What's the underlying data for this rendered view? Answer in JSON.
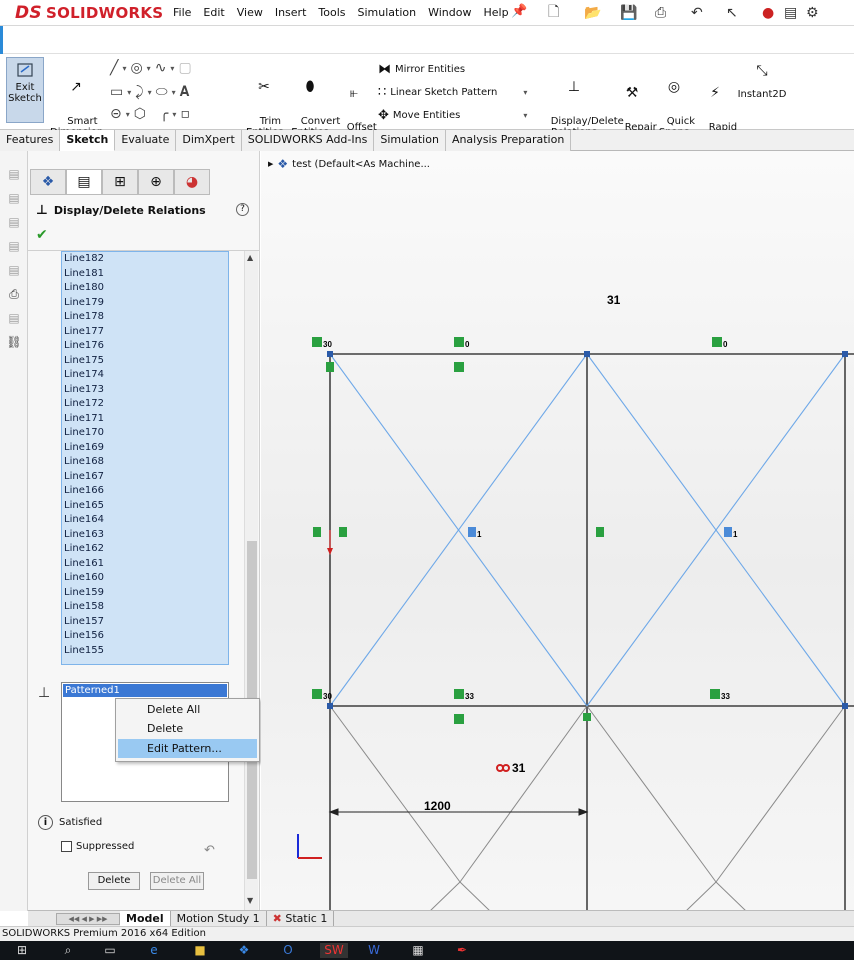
{
  "app": {
    "brand_ds": "DS",
    "brand_solid": "SOLIDWORKS"
  },
  "menu": [
    "File",
    "Edit",
    "View",
    "Insert",
    "Tools",
    "Simulation",
    "Window",
    "Help"
  ],
  "ribbon": {
    "exit_sketch": "Exit\nSketch",
    "smart_dimension": "Smart\nDimension",
    "trim_entities": "Trim\nEntities",
    "convert_entities": "Convert\nEntities",
    "offset_entities": "Offset\nEntities",
    "mirror_entities": "Mirror Entities",
    "linear_sketch_pattern": "Linear Sketch Pattern",
    "move_entities": "Move Entities",
    "display_delete_relations": "Display/Delete\nRelations",
    "repair_sketch": "Repair\nSketch",
    "quick_snaps": "Quick\nSnaps",
    "rapid_sketch": "Rapid\nSketch",
    "instant2d": "Instant2D"
  },
  "tabs": [
    "Features",
    "Sketch",
    "Evaluate",
    "DimXpert",
    "SOLIDWORKS Add-Ins",
    "Simulation",
    "Analysis Preparation"
  ],
  "active_tab": "Sketch",
  "property_manager": {
    "title": "Display/Delete Relations",
    "help": "?",
    "entities": [
      "Line182",
      "Line181",
      "Line180",
      "Line179",
      "Line178",
      "Line177",
      "Line176",
      "Line175",
      "Line174",
      "Line173",
      "Line172",
      "Line171",
      "Line170",
      "Line169",
      "Line168",
      "Line167",
      "Line166",
      "Line165",
      "Line164",
      "Line163",
      "Line162",
      "Line161",
      "Line160",
      "Line159",
      "Line158",
      "Line157",
      "Line156",
      "Line155"
    ],
    "relation_selected": "Patterned1",
    "status": "Satisfied",
    "suppressed_label": "Suppressed",
    "delete_label": "Delete",
    "delete_all_label": "Delete All"
  },
  "context_menu": {
    "items": [
      "Delete All",
      "Delete",
      "Edit Pattern..."
    ],
    "highlighted_index": 2
  },
  "tree": {
    "label": "test  (Default<As Machine..."
  },
  "sketch": {
    "dimension_top": "31",
    "dimension_mid": "31",
    "dimension_length": "1200",
    "relation_labels": [
      "30",
      "0",
      "0",
      "1",
      "1",
      "30",
      "33",
      "33"
    ]
  },
  "bottom_tabs": [
    "Model",
    "Motion Study 1",
    "Static 1"
  ],
  "status_bar": "SOLIDWORKS Premium 2016 x64 Edition"
}
